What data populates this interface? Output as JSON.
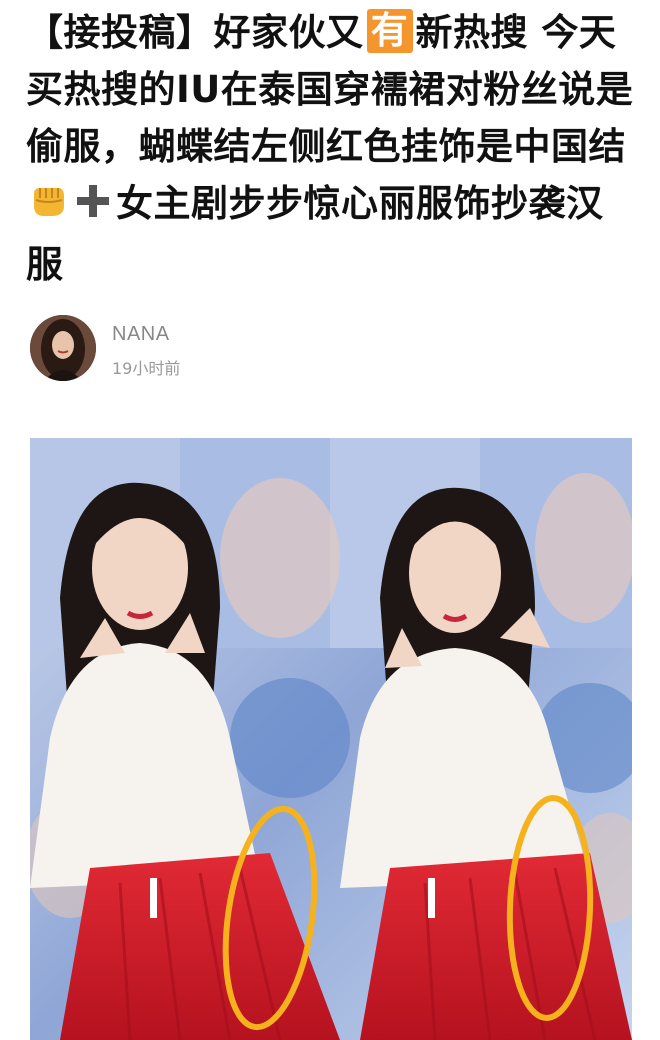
{
  "headline": {
    "part1": "【接投稿】好家伙又",
    "badge": "有",
    "part2": "新热搜 今天买热搜的IU在泰国穿襦裙对粉丝说是偷服，蝴蝶结左侧红色挂饰是中国结",
    "part3": "女主剧步步惊心丽服饰抄袭汉服"
  },
  "author": {
    "name": "NANA",
    "time": "19小时前"
  },
  "icons": {
    "fist": "fist-emoji-icon",
    "plus": "heavy-plus-icon",
    "avatar": "user-avatar-photo"
  },
  "colors": {
    "badge": "#f4952e",
    "annotation_circle": "#f5b21c",
    "skirt": "#d9232e"
  }
}
